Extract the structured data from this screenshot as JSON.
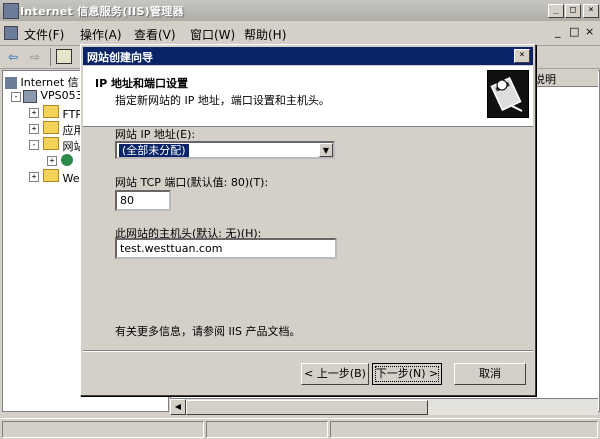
{
  "window": {
    "title": "Internet 信息服务(IIS)管理器",
    "minimize_glyph": "_",
    "maximize_glyph": "□",
    "close_glyph": "×"
  },
  "menu": {
    "items": [
      {
        "label": "文件(F)"
      },
      {
        "label": "操作(A)"
      },
      {
        "label": "查看(V)"
      },
      {
        "label": "窗口(W)"
      },
      {
        "label": "帮助(H)"
      }
    ],
    "right_controls": [
      "_",
      "□",
      "×"
    ]
  },
  "toolbar": {
    "back_glyph": "⇦",
    "forward_glyph": "⇨"
  },
  "tree": {
    "root": "Internet 信",
    "server": "VPS053",
    "children": [
      {
        "label": "FTP"
      },
      {
        "label": "应用"
      },
      {
        "label": "网站"
      },
      {
        "label": ""
      },
      {
        "label": "Web"
      }
    ]
  },
  "right_header_fragment": "说明",
  "dialog": {
    "title": "网站创建向导",
    "close_glyph": "×",
    "header_title": "IP 地址和端口设置",
    "header_subtitle": "指定新网站的 IP 地址，端口设置和主机头。",
    "ip_label": "网站 IP 地址(E):",
    "ip_value": "(全部未分配)",
    "port_label": "网站 TCP 端口(默认值: 80)(T):",
    "port_value": "80",
    "host_label": "此网站的主机头(默认: 无)(H):",
    "host_value": "test.westtuan.com",
    "info": "有关更多信息，请参阅 IIS 产品文档。",
    "buttons": {
      "back": "< 上一步(B)",
      "next": "下一步(N) >",
      "cancel": "取消"
    }
  }
}
